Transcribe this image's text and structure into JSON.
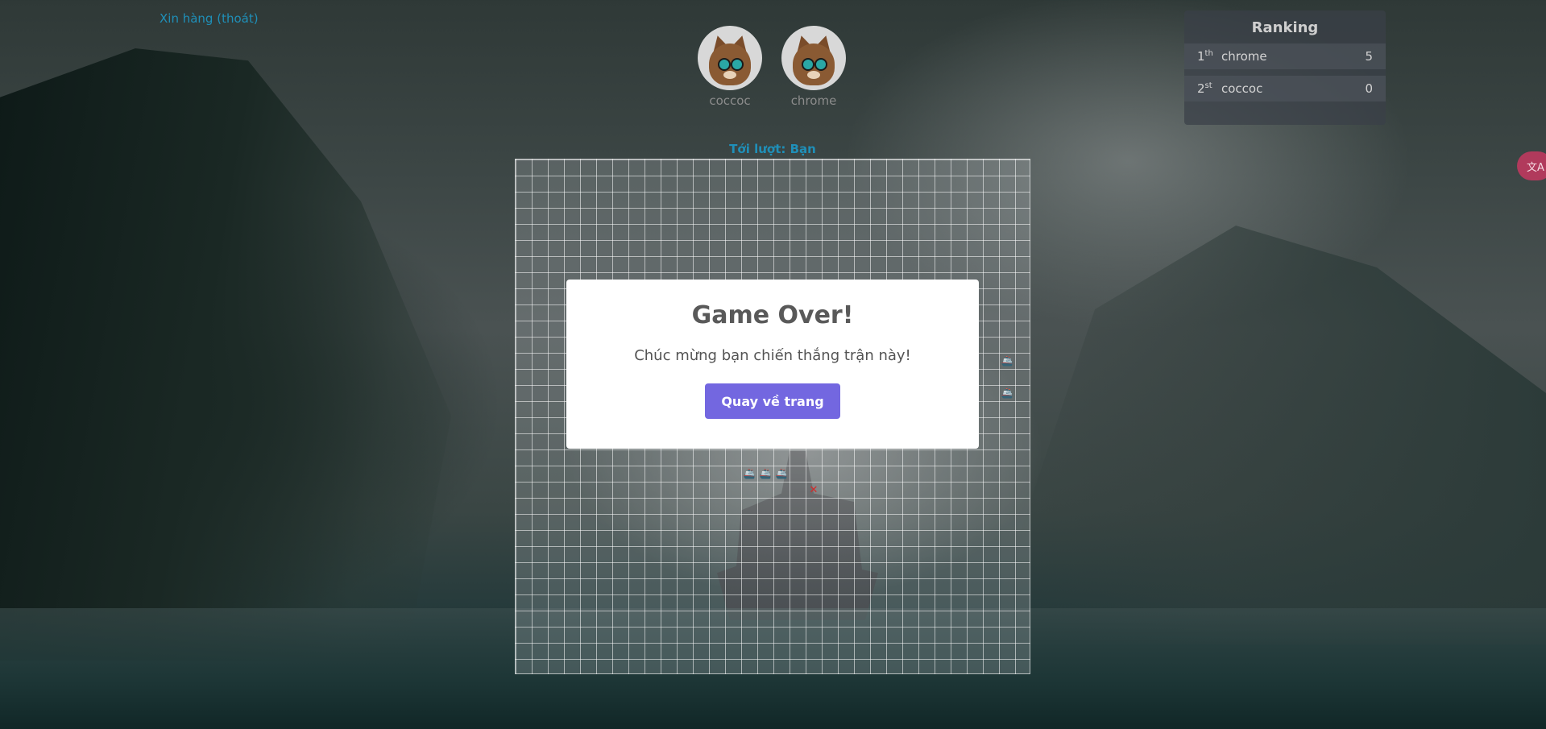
{
  "header": {
    "resign_link": "Xin hàng (thoát)"
  },
  "players": [
    {
      "name": "coccoc",
      "avatar_icon": "kitten-avatar"
    },
    {
      "name": "chrome",
      "avatar_icon": "kitten-avatar"
    }
  ],
  "turn_label": "Tới lượt: Bạn",
  "ranking": {
    "title": "Ranking",
    "rows": [
      {
        "pos": "1",
        "suffix": "th",
        "name": "chrome",
        "score": "5"
      },
      {
        "pos": "2",
        "suffix": "st",
        "name": "coccoc",
        "score": "0"
      }
    ]
  },
  "board": {
    "boat_symbol": "🚢",
    "hit_symbol": "✕"
  },
  "modal": {
    "title": "Game Over!",
    "message": "Chúc mừng bạn chiến thắng trận này!",
    "button_label": "Quay về trang chủ"
  },
  "colors": {
    "accent_link": "#1f8fb8",
    "button": "#7367e0",
    "translate_badge": "#b13a5c"
  },
  "translate_icon_label": "文A"
}
